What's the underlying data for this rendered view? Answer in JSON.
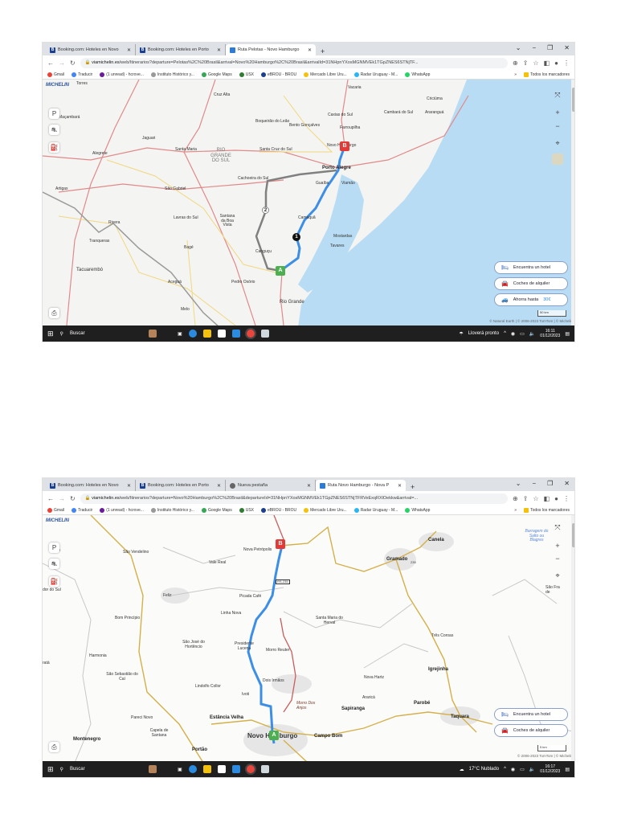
{
  "bookmarks": [
    {
      "label": "Gmail",
      "icon": "gmail-icon"
    },
    {
      "label": "Traducir",
      "icon": "translate-icon"
    },
    {
      "label": "(1 unread) - hcrove...",
      "icon": "mail-icon"
    },
    {
      "label": "Instituto Histórico y...",
      "icon": "site-icon"
    },
    {
      "label": "Google Maps",
      "icon": "maps-pin-icon"
    },
    {
      "label": "USX",
      "icon": "usx-icon"
    },
    {
      "label": "eBROU - BROU",
      "icon": "brou-icon"
    },
    {
      "label": "Mercado Libre Uru...",
      "icon": "mercadolibre-icon"
    },
    {
      "label": "Radar Uruguay - M...",
      "icon": "radar-icon"
    },
    {
      "label": "WhatsApp",
      "icon": "whatsapp-icon"
    }
  ],
  "bookmarks_more": "»",
  "bookmarks_all": "Todos los marcadores",
  "map_buttons": {
    "hotel": "Encuentra un hotel",
    "cars": "Coches de alquiler",
    "save": "Ahorra hasta",
    "save_amount": "30€"
  },
  "logo": "MICHELIN",
  "search_label": "Buscar",
  "window1": {
    "tabs": [
      "Booking.com: Hoteles en Novo",
      "Booking.com: Hoteles en Porto",
      "Ruta Pelotas - Novo Hamburgo"
    ],
    "url_host": "viamichelin.es",
    "url_path": "/web/Itinerarios?departure=Pelotas%2C%20Brasil&arrival=Novo%20Hamburgo%2C%20Brasil&arrivalId=31NHpnYXosMGNMVEk1TGpZNES6STNjTF...",
    "labels": [
      "Cruz Alta",
      "Vacaria",
      "Criciúma",
      "Maçambará",
      "Caxias do Sul",
      "Cambará do Sul",
      "Araranguá",
      "Boqueirão do Leão",
      "Bento Gonçalves",
      "Farroupilha",
      "Jaguari",
      "Novo Hamburgo",
      "Santa Maria",
      "RIO GRANDE DO SUL",
      "Santa Cruz do Sul",
      "Alegrete",
      "Porto Alegre",
      "Cachoeira do Sul",
      "Guaíba",
      "Viamão",
      "Artigas",
      "São Gabriel",
      "Lavras do Sul",
      "Santana da Boa Vista",
      "Camaquã",
      "Rivera",
      "Mostardas",
      "Tranqueras",
      "Tavares",
      "Bagé",
      "Canguçu",
      "Tacuarembó",
      "Aceguá",
      "Pedro Osório",
      "Rio Grande",
      "Melo",
      "Torres"
    ],
    "markers": {
      "start": "A",
      "end": "B",
      "step1": "1",
      "step2": "2"
    },
    "scale": "50 km",
    "attribution": "© Natural Earth | © 2006-2023 TomTom | © Michelin",
    "weather": "Lloverá pronto",
    "time": "16:11",
    "date": "01/12/2023"
  },
  "window2": {
    "tabs": [
      "Booking.com: Hoteles en Novo",
      "Booking.com: Hoteles en Porto",
      "Nueva pestaña",
      "Ruta Novo Hamburgo - Nova P"
    ],
    "url_host": "viamichelin.es",
    "url_path": "/web/Itinerarios?departure=Novo%20Hamburgo%2C%20Brasil&departureId=31NHpnYXosMGNMVEk1TGpZNES6STNjTFRVeExqRXlOekkw&arrival=...",
    "labels": [
      "São Vendelino",
      "Nova Petrópolis",
      "Vale Real",
      "Gramado",
      "Canela",
      "Barragem do Salto ou Blagres",
      "ardo",
      "dor do Sul",
      "Feliz",
      "Picada Café",
      "São Fra de",
      "Linha Nova",
      "Bom Princípio",
      "Santa Maria do Herval",
      "São José do Hortêncio",
      "Presidente Lucena",
      "Morro Reuter",
      "Três Coroas",
      "Harmonia",
      "Igrejinha",
      "São Sebastião do Caí",
      "Dois Irmãos",
      "Nova Hartz",
      "Lindolfo Collor",
      "Ivoti",
      "Araricá",
      "Morro Dos Anjos",
      "Sapiranga",
      "Parobé",
      "Taquara",
      "Estância Velha",
      "Pareci Novo",
      "Capela de Santana",
      "Montenegro",
      "Novo Hamburgo",
      "Campo Bom",
      "Portão",
      "RS-235",
      "235",
      "ratá"
    ],
    "markers": {
      "start": "A",
      "end": "B"
    },
    "scale": "5 km",
    "attribution": "© 2006-2023 TomTom | © Michelin",
    "weather": "17°C Nublado",
    "time": "16:17",
    "date": "01/12/2023"
  }
}
